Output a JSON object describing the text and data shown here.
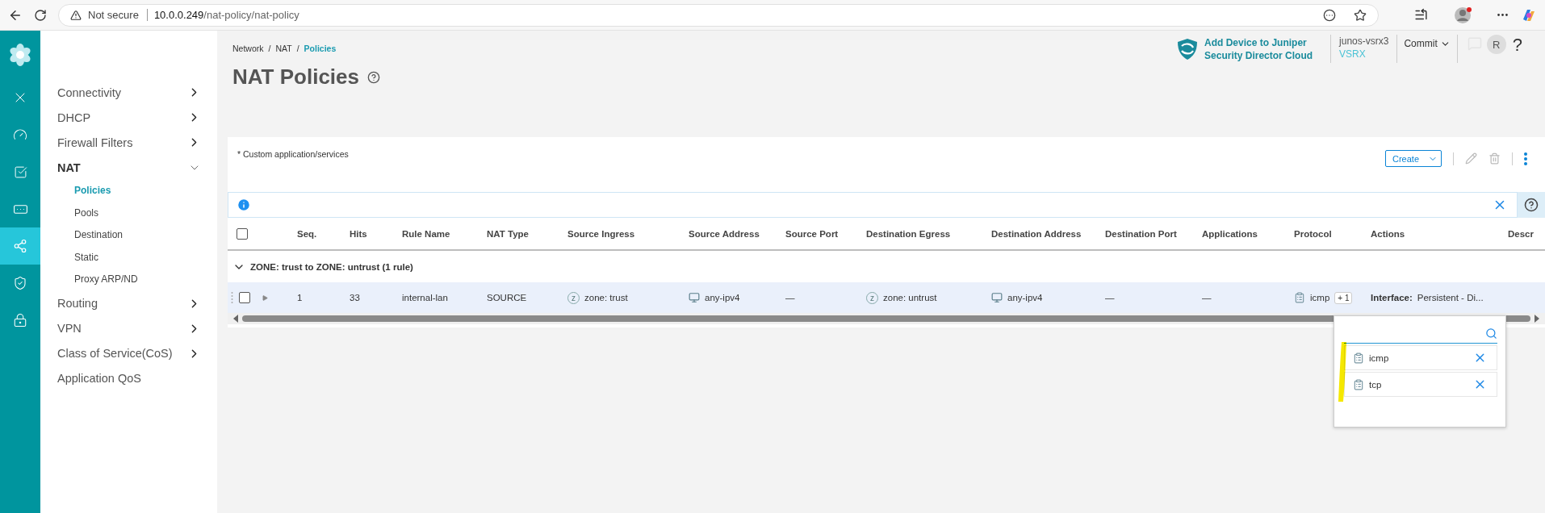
{
  "browser": {
    "security": "Not secure",
    "url_host": "10.0.0.249",
    "url_path": "/nat-policy/nat-policy"
  },
  "rail": {
    "items": [
      {
        "kind": "close",
        "selected": false
      },
      {
        "kind": "dashboard",
        "selected": false
      },
      {
        "kind": "monitor",
        "selected": false
      },
      {
        "kind": "devices",
        "selected": false
      },
      {
        "kind": "network",
        "selected": true
      },
      {
        "kind": "security",
        "selected": false
      },
      {
        "kind": "lock",
        "selected": false
      }
    ]
  },
  "nav": {
    "items": [
      {
        "label": "Connectivity",
        "expanded": false
      },
      {
        "label": "DHCP",
        "expanded": false
      },
      {
        "label": "Firewall Filters",
        "expanded": false
      },
      {
        "label": "NAT",
        "expanded": true,
        "children": [
          {
            "label": "Policies",
            "selected": true
          },
          {
            "label": "Pools",
            "selected": false
          },
          {
            "label": "Destination",
            "selected": false
          },
          {
            "label": "Static",
            "selected": false
          },
          {
            "label": "Proxy ARP/ND",
            "selected": false
          }
        ]
      },
      {
        "label": "Routing",
        "expanded": false
      },
      {
        "label": "VPN",
        "expanded": false
      },
      {
        "label": "Class of Service(CoS)",
        "expanded": false
      },
      {
        "label": "Application QoS"
      }
    ]
  },
  "breadcrumb": {
    "separator": "/",
    "items": [
      {
        "label": "Network",
        "selected": false
      },
      {
        "label": "NAT",
        "selected": false
      },
      {
        "label": "Policies",
        "selected": true
      }
    ]
  },
  "header": {
    "promo": "Add Device to Juniper Security Director Cloud",
    "device": "junos-vsrx3",
    "model": "VSRX",
    "commit": "Commit",
    "avatar": "R",
    "help": "?"
  },
  "title": "NAT Policies",
  "card": {
    "note": "* Custom application/services",
    "create": "Create",
    "actions": [
      {
        "kind": "edit",
        "disabled": true
      },
      {
        "kind": "delete",
        "disabled": true
      },
      {
        "kind": "more",
        "disabled": false
      }
    ],
    "select_all": {
      "checked": false
    },
    "columns": [
      "Seq.",
      "Hits",
      "Rule Name",
      "NAT Type",
      "Source Ingress",
      "Source Address",
      "Source Port",
      "Destination Egress",
      "Destination Address",
      "Destination Port",
      "Applications",
      "Protocol",
      "Actions",
      "Descr"
    ],
    "groups": [
      {
        "label": "ZONE: trust to ZONE: untrust (1 rule)",
        "expanded": true,
        "rows": [
          {
            "selected": false,
            "expanded": false,
            "cells": [
              {
                "kind": "text",
                "text": "1"
              },
              {
                "kind": "text",
                "text": "33"
              },
              {
                "kind": "text",
                "text": "internal-lan"
              },
              {
                "kind": "text",
                "text": "SOURCE"
              },
              {
                "kind": "zone",
                "badge": "z",
                "text": "zone: trust"
              },
              {
                "kind": "address",
                "text": "any-ipv4"
              },
              {
                "kind": "text",
                "text": "—"
              },
              {
                "kind": "zone",
                "badge": "z",
                "text": "zone: untrust"
              },
              {
                "kind": "address",
                "text": "any-ipv4"
              },
              {
                "kind": "text",
                "text": "—"
              },
              {
                "kind": "text",
                "text": "—"
              },
              {
                "kind": "protocol",
                "text": "icmp",
                "more": "+ 1"
              },
              {
                "kind": "rich",
                "text": "**Interface:** Persistent - Di..."
              }
            ]
          }
        ]
      }
    ],
    "popup": {
      "items": [
        "icmp",
        "tcp"
      ]
    }
  }
}
